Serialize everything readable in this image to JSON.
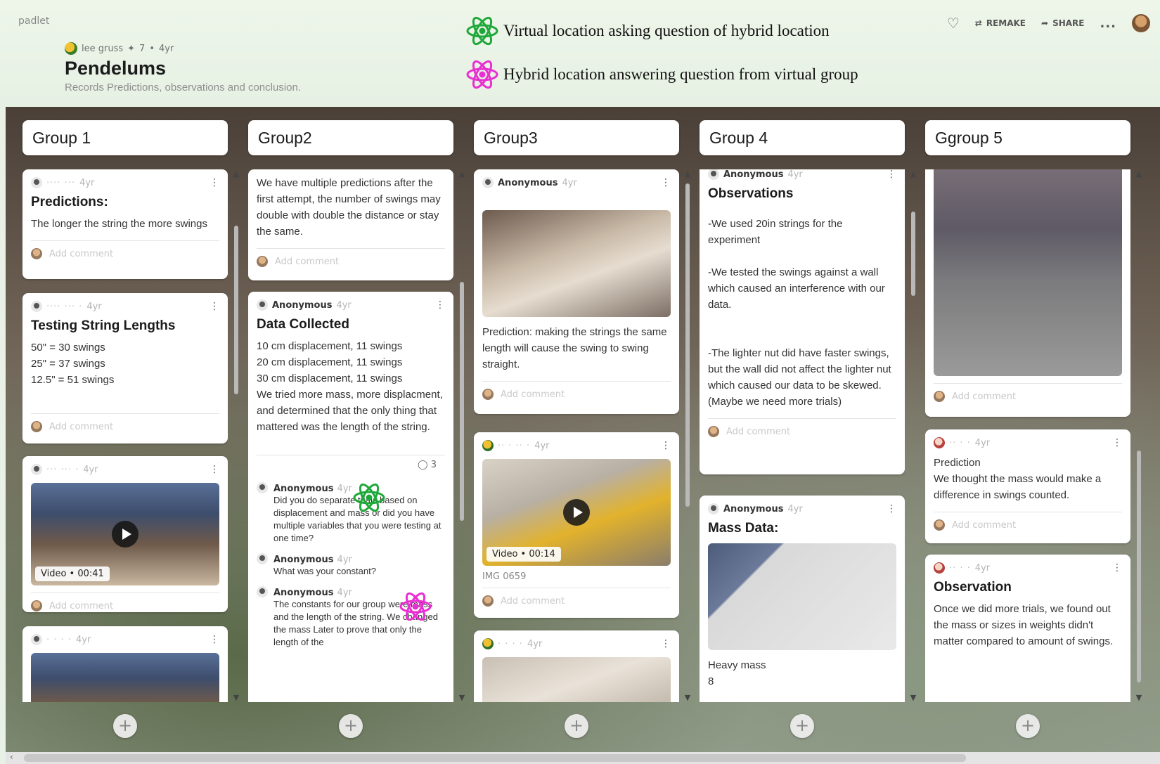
{
  "app": {
    "brand": "padlet"
  },
  "header": {
    "author": "lee gruss",
    "likes": "7",
    "age": "4yr",
    "title": "Pendelums",
    "subtitle": "Records Predictions, observations and conclusion.",
    "legend": [
      {
        "text": "Virtual location asking question of hybrid location",
        "color": "#1fa83a"
      },
      {
        "text": "Hybrid location answering question from virtual group",
        "color": "#e82fd2"
      }
    ],
    "actions": {
      "remake": "REMAKE",
      "share": "SHARE",
      "more": "..."
    }
  },
  "add_comment": "Add comment",
  "columns": [
    {
      "title": "Group 1",
      "cards": [
        {
          "age": "4yr",
          "title": "Predictions:",
          "text": "The longer the string the more swings"
        },
        {
          "age": "4yr",
          "title": "Testing String Lengths",
          "text": "50\" = 30 swings\n25\" = 37 swings\n12.5\" = 51 swings"
        },
        {
          "age": "4yr",
          "video": "Video • 00:41"
        },
        {
          "age": "4yr"
        }
      ]
    },
    {
      "title": "Group2",
      "cards": [
        {
          "text": "We have multiple predictions after the first attempt, the number of swings may double with double the distance or stay the same."
        },
        {
          "author": "Anonymous",
          "age": "4yr",
          "title": "Data Collected",
          "text": "10 cm displacement, 11 swings\n20 cm displacement, 11 swings\n30 cm displacement, 11 swings\nWe tried more mass, more displacment, and determined that the only thing that mattered was the length of the string.",
          "comment_count": "3",
          "replies": [
            {
              "author": "Anonymous",
              "age": "4yr",
              "text": "Did you do separate trials based on displacement and mass or did you have multiple variables that you were testing at one time?"
            },
            {
              "author": "Anonymous",
              "age": "4yr",
              "text": "What was your constant?"
            },
            {
              "author": "Anonymous",
              "age": "4yr",
              "text": "The constants for our group were mass and the length of the string. We changed the mass Later to prove that only the length of the"
            }
          ]
        }
      ]
    },
    {
      "title": "Group3",
      "cards": [
        {
          "author": "Anonymous",
          "age": "4yr",
          "text": "Prediction: making the strings the same length will cause the swing to swing straight."
        },
        {
          "age": "4yr",
          "video": "Video • 00:14",
          "caption": "IMG 0659"
        },
        {
          "age": "4yr"
        }
      ]
    },
    {
      "title": "Group 4",
      "cards": [
        {
          "author": "Anonymous",
          "age": "4yr",
          "title": "Observations",
          "text": "-We used 20in strings for the experiment\n\n-We tested the swings against a wall which caused an interference with our data.\n\n\n-The lighter nut did have faster swings, but the wall did not affect the lighter nut which caused our data to be skewed.\n(Maybe we need more trials)"
        },
        {
          "author": "Anonymous",
          "age": "4yr",
          "title": "Mass Data:",
          "text": "Heavy mass\n8"
        }
      ]
    },
    {
      "title": "Ggroup 5",
      "cards": [
        {},
        {
          "age": "4yr",
          "text": "Prediction\nWe thought the mass would make a difference in swings counted."
        },
        {
          "age": "4yr",
          "title": "Observation",
          "text": "Once we did more trials, we found out the mass or sizes in weights didn't matter compared to amount of swings."
        }
      ]
    }
  ]
}
